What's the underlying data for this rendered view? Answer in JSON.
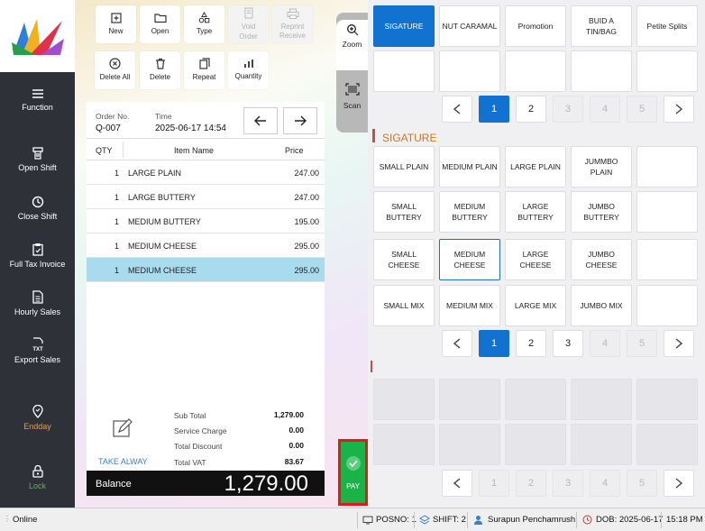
{
  "sidebar": {
    "items": [
      {
        "label": "Function",
        "icon": "menu-icon"
      },
      {
        "label": "Open Shift",
        "icon": "shift-open-icon"
      },
      {
        "label": "Close Shift",
        "icon": "clock-icon"
      },
      {
        "label": "Full Tax Invoice",
        "icon": "clipboard-icon"
      },
      {
        "label": "Hourly Sales",
        "icon": "document-icon"
      },
      {
        "label": "Export Sales",
        "icon": "txt-file-icon"
      },
      {
        "label": "Endday",
        "icon": "location-icon",
        "color": "#f0a030"
      },
      {
        "label": "Lock",
        "icon": "lock-icon",
        "color": "#3fc060"
      }
    ]
  },
  "toolbar": {
    "new": "New",
    "open": "Open",
    "type": "Type",
    "void": "Void\nOrder",
    "reprint": "Reprint\nReceive",
    "delete_all": "Delete All",
    "delete": "Delete",
    "repeat": "Repeat",
    "quantity": "Quantity"
  },
  "side_tab": {
    "zoom": "Zoom",
    "scan": "Scan"
  },
  "order": {
    "order_no_label": "Order No.",
    "order_no": "Q-007",
    "time_label": "Time",
    "time": "2025-06-17 14:54",
    "col_qty": "QTY",
    "col_item": "Item Name",
    "col_price": "Price",
    "items": [
      {
        "qty": "1",
        "name": "LARGE PLAIN",
        "price": "247.00"
      },
      {
        "qty": "1",
        "name": "LARGE BUTTERY",
        "price": "247.00"
      },
      {
        "qty": "1",
        "name": "MEDIUM BUTTERY",
        "price": "195.00"
      },
      {
        "qty": "1",
        "name": "MEDIUM CHEESE",
        "price": "295.00"
      },
      {
        "qty": "1",
        "name": "MEDIUM CHEESE",
        "price": "295.00"
      }
    ],
    "order_type": "TAKE ALWAY",
    "sub_total_label": "Sub Total",
    "sub_total": "1,279.00",
    "service_label": "Service Charge",
    "service": "0.00",
    "discount_label": "Total Discount",
    "discount": "0.00",
    "vat_label": "Total VAT",
    "vat": "83.67",
    "balance_label": "Balance",
    "balance": "1,279.00"
  },
  "pay": {
    "label": "PAY"
  },
  "categories": {
    "items": [
      "SIGATURE",
      "NUT CARAMAL",
      "Promotion",
      "BUID A\nTIN/BAG",
      "Petite Splits"
    ],
    "pages": [
      "1",
      "2",
      "3",
      "4",
      "5"
    ]
  },
  "section": {
    "title": "SIGATURE",
    "accent": "#c0504d"
  },
  "products": {
    "items": [
      "SMALL PLAIN",
      "MEDIUM PLAIN",
      "LARGE PLAIN",
      "JUMMBO PLAIN",
      "SMALL\nBUTTERY",
      "MEDIUM\nBUTTERY",
      "LARGE\nBUTTERY",
      "JUMBO\nBUTTERY",
      "SMALL CHEESE",
      "MEDIUM\nCHEESE",
      "LARGE CHEESE",
      "JUMBO CHEESE",
      "SMALL MIX",
      "MEDIUM MIX",
      "LARGE MIX",
      "JUMBO MIX"
    ],
    "pages": [
      "1",
      "2",
      "3",
      "4",
      "5"
    ]
  },
  "bottom_pages": [
    "1",
    "2",
    "3",
    "4",
    "5"
  ],
  "status": {
    "online": "Online",
    "posno": "POSNO: 1",
    "shift": "SHIFT: 2",
    "user": "Surapun Penchamrush",
    "dob": "DOB: 2025-06-17",
    "time": "15:18 PM"
  },
  "colors": {
    "accent": "#1173cf",
    "sidebar": "#2e3138",
    "pay": "#19b34a"
  }
}
